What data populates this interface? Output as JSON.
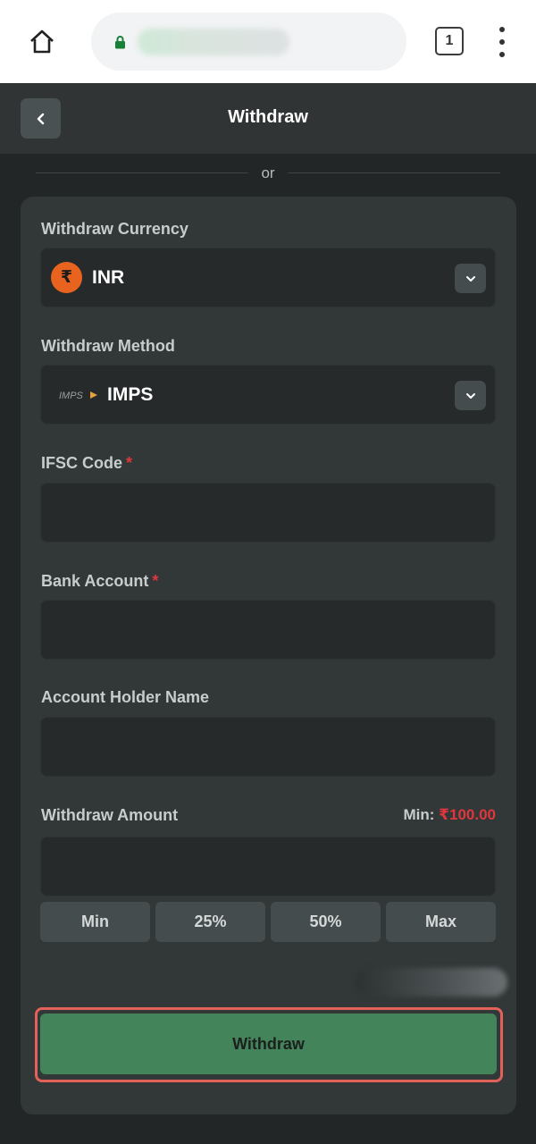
{
  "browser": {
    "tab_count": "1"
  },
  "header": {
    "title": "Withdraw"
  },
  "divider": {
    "text": "or"
  },
  "form": {
    "currency": {
      "label": "Withdraw Currency",
      "value": "INR",
      "icon": "rupee-icon"
    },
    "method": {
      "label": "Withdraw Method",
      "value": "IMPS",
      "logo_text": "IMPS"
    },
    "ifsc": {
      "label": "IFSC Code",
      "required": "*",
      "value": ""
    },
    "bank_account": {
      "label": "Bank Account",
      "required": "*",
      "value": ""
    },
    "holder_name": {
      "label": "Account Holder Name",
      "value": ""
    },
    "amount": {
      "label": "Withdraw Amount",
      "min_label": "Min:",
      "min_value": "₹100.00",
      "value": "",
      "quick_buttons": [
        "Min",
        "25%",
        "50%",
        "Max"
      ]
    },
    "submit_label": "Withdraw"
  },
  "colors": {
    "background": "#232626",
    "card": "#323738",
    "field": "#262a2b",
    "accent_green": "#44845a",
    "required_red": "#e0363d",
    "rupee_orange": "#e8631e",
    "highlight_outline": "#e2625a"
  }
}
